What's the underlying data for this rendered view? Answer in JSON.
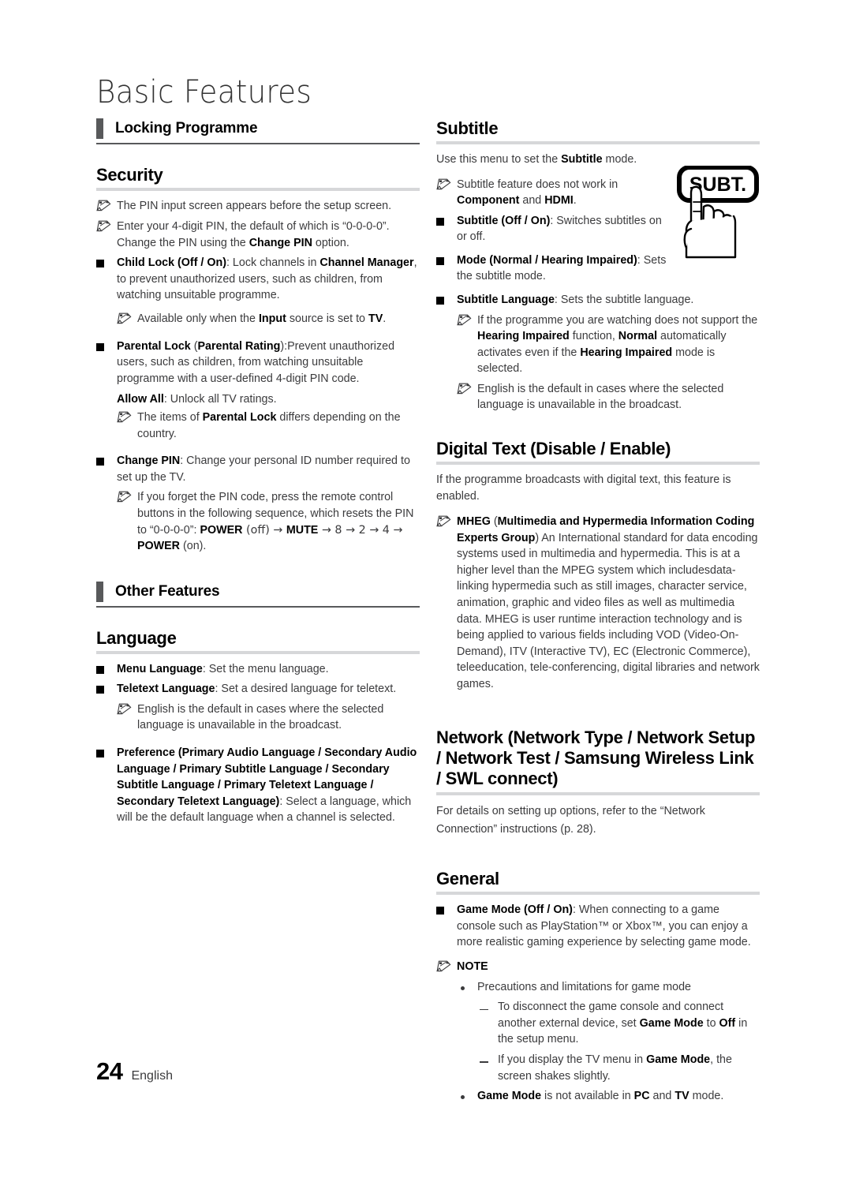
{
  "page": {
    "title": "Basic Features",
    "footer_number": "24",
    "footer_language": "English"
  },
  "left_column": {
    "section_heading": "Locking Programme",
    "security": {
      "heading": "Security",
      "notes": [
        "The PIN input screen appears before the setup screen."
      ],
      "note2_line1": "Enter your 4-digit PIN, the default of which is “0-0-0-0”.",
      "note2_line2_pre": "Change the PIN using the ",
      "note2_line2_bold": "Change PIN",
      "note2_line2_post": " option.",
      "child_lock": {
        "bold1": "Child Lock (Off / On)",
        "text1": ": Lock channels in ",
        "bold2": "Channel Manager",
        "text2": ", to prevent unauthorized users, such as children, from watching unsuitable programme.",
        "sub_note_pre": "Available only when the ",
        "sub_note_bold1": "Input",
        "sub_note_mid": " source is set to ",
        "sub_note_bold2": "TV",
        "sub_note_post": "."
      },
      "parental_lock": {
        "bold1": "Parental Lock",
        "paren_pre": " (",
        "bold2": "Parental Rating",
        "text1": "):Prevent unauthorized users, such as children, from watching unsuitable programme with a user-defined 4-digit PIN code.",
        "allow_all_bold": "Allow All",
        "allow_all_text": ": Unlock all TV ratings.",
        "note_pre": "The items of ",
        "note_bold": "Parental Lock",
        "note_post": " differs depending on the country."
      },
      "change_pin": {
        "bold": "Change PIN",
        "text": ": Change your personal ID number required to set up the TV.",
        "note_line1": "If you forget the PIN code, press the remote control buttons in the following sequence, which resets the PIN to “0-0-0-0”: ",
        "note_bold_power1": "POWER",
        "note_off": " (off) → ",
        "note_bold_mute": "MUTE",
        "note_seq": " → 8 → 2 → 4 → ",
        "note_bold_power2": "POWER",
        "note_on": " (on)."
      }
    },
    "other_features": {
      "section_heading": "Other Features",
      "language": {
        "heading": "Language",
        "menu_language_bold": "Menu Language",
        "menu_language_text": ": Set the menu language.",
        "teletext_bold": "Teletext Language",
        "teletext_text": ": Set a desired language for teletext.",
        "teletext_note": "English is the default in cases where the selected language is unavailable in the broadcast.",
        "preference_bold": "Preference (Primary Audio Language / Secondary Audio Language / Primary Subtitle Language / Secondary Subtitle Language / Primary Teletext Language / Secondary Teletext Language)",
        "preference_text": ": Select a language, which will be the default language when a channel is selected."
      }
    }
  },
  "right_column": {
    "subtitle": {
      "heading": "Subtitle",
      "intro_pre": "Use this menu to set the ",
      "intro_bold": "Subtitle",
      "intro_post": " mode.",
      "note1_pre": "Subtitle feature does not work in ",
      "note1_bold1": "Component",
      "note1_mid": " and ",
      "note1_bold2": "HDMI",
      "note1_post": ".",
      "item1_bold": "Subtitle (Off / On)",
      "item1_text": ": Switches subtitles on or off.",
      "item2_bold": "Mode (Normal / Hearing Impaired)",
      "item2_text": ": Sets the subtitle mode.",
      "item3_bold": "Subtitle Language",
      "item3_text": ": Sets the subtitle language.",
      "item3_note1_pre": "If the programme you are watching does not support the ",
      "item3_note1_bold1": "Hearing Impaired",
      "item3_note1_mid1": " function, ",
      "item3_note1_bold2": "Normal",
      "item3_note1_mid2": " automatically activates even if the ",
      "item3_note1_bold3": "Hearing Impaired",
      "item3_note1_post": " mode is selected.",
      "item3_note2": "English is the default in cases where the selected language is unavailable in the broadcast.",
      "remote_button_label": "SUBT."
    },
    "digital_text": {
      "heading": "Digital Text (Disable / Enable)",
      "intro": "If the programme broadcasts with digital text, this feature is enabled.",
      "mheg_bold1": "MHEG",
      "mheg_paren_open": " (",
      "mheg_bold2": "Multimedia and Hypermedia Information Coding Experts Group",
      "mheg_text": ") An International standard for data encoding systems used in multimedia and hypermedia. This is at a higher level than the MPEG system which includesdata-linking hypermedia such as still images, character service, animation, graphic and video files as well as multimedia data. MHEG is user runtime interaction technology and is being applied to various fields including VOD (Video-On-Demand), ITV (Interactive TV), EC (Electronic Commerce), teleeducation, tele-conferencing, digital libraries and network games."
    },
    "network": {
      "heading": "Network (Network Type / Network Setup / Network Test / Samsung Wireless Link / SWL connect)",
      "text": "For details on setting up options, refer to the “Network Connection” instructions (p. 28)."
    },
    "general": {
      "heading": "General",
      "game_mode_bold": "Game Mode (Off / On)",
      "game_mode_text": ": When connecting to a game console such as PlayStation™ or Xbox™, you can enjoy a more realistic gaming experience by selecting game mode.",
      "note_label": "NOTE",
      "bullet1": "Precautions and limitations for game mode",
      "sub1_pre": "To disconnect the game console and connect another external device, set ",
      "sub1_bold1": "Game Mode",
      "sub1_mid": " to ",
      "sub1_bold2": "Off",
      "sub1_post": " in the setup menu.",
      "sub2_pre": "If you display the TV menu in ",
      "sub2_bold": "Game Mode",
      "sub2_post": ", the screen shakes slightly.",
      "bullet2_bold1": "Game Mode",
      "bullet2_mid1": " is not available in ",
      "bullet2_bold2": "PC",
      "bullet2_mid2": " and ",
      "bullet2_bold3": "TV",
      "bullet2_post": " mode."
    }
  },
  "colors": {
    "marker": "#58595b",
    "rule": "#d6d7d9",
    "body_text": "#3b3b3d"
  }
}
